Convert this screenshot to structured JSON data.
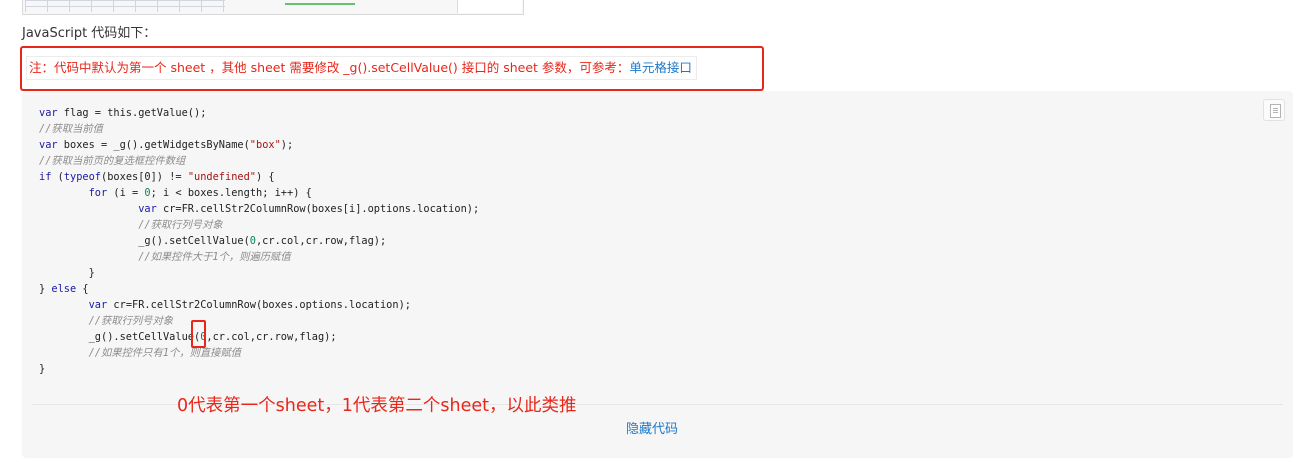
{
  "intro": "JavaScript 代码如下：",
  "note": {
    "text": "注：代码中默认为第一个 sheet ，其他 sheet 需要修改 _g().setCellValue() 接口的 sheet 参数，可参考：",
    "link": "单元格接口"
  },
  "code": {
    "lines": [
      "var flag = this.getValue();",
      "//获取当前值",
      "var boxes = _g().getWidgetsByName(\"box\");",
      "//获取当前页的复选框控件数组",
      "if (typeof(boxes[0]) != \"undefined\") {",
      "        for (i = 0; i < boxes.length; i++) {",
      "                var cr=FR.cellStr2ColumnRow(boxes[i].options.location);",
      "                //获取行列号对象",
      "                _g().setCellValue(0,cr.col,cr.row,flag);",
      "                //如果控件大于1个，则遍历赋值",
      "        }",
      "} else {",
      "        var cr=FR.cellStr2ColumnRow(boxes.options.location);",
      "        //获取行列号对象",
      "        _g().setCellValue(0,cr.col,cr.row,flag);",
      "        //如果控件只有1个，则直接赋值",
      "}"
    ]
  },
  "annotation": "0代表第一个sheet，1代表第二个sheet，以此类推",
  "hide_code": "隐藏代码",
  "colors": {
    "annotation_red": "#e8261a",
    "link_blue": "#1e78c8",
    "panel_bg": "#f6f6f6"
  },
  "icons": [
    "copy-icon"
  ]
}
